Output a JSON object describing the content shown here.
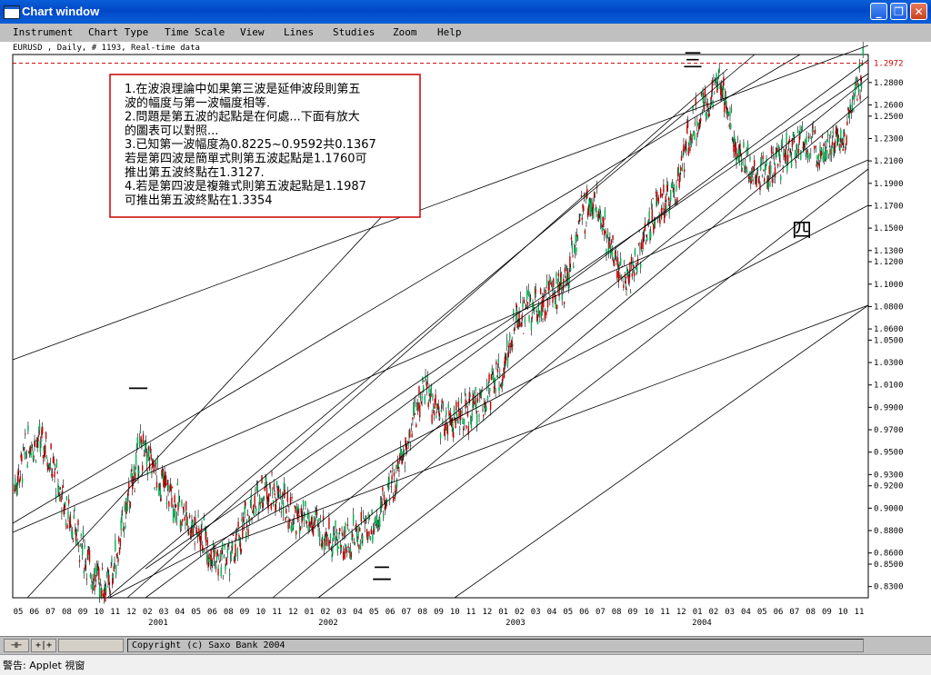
{
  "window": {
    "title": "Chart window"
  },
  "menu": [
    "Instrument",
    "Chart Type",
    "Time Scale",
    "View",
    "Lines",
    "Studies",
    "Zoom",
    "Help"
  ],
  "chart_header": "EURUSD , Daily, # 1193, Real-time data",
  "annotation_lines": [
    "1.在波浪理論中如果第三波是延伸波段則第五",
    "波的幅度与第一波幅度相等.",
    "2.問題是第五波的起點是在何處...下面有放大",
    "的圖表可以對照...",
    "3.已知第一波幅度為0.8225~0.9592共0.1367",
    "若是第四波是簡單式則第五波起點是1.1760可",
    "推出第五波終點在1.3127.",
    "4.若是第四波是複雜式則第五波起點是1.1987",
    "可推出第五波終點在1.3354"
  ],
  "wave_labels": [
    "一",
    "二",
    "三",
    "四"
  ],
  "status": {
    "btn1": "⊣⊢",
    "btn2": "+|+",
    "copyright": "Copyright (c) Saxo Bank 2004"
  },
  "java_status": "警告: Applet 視窗",
  "colors": {
    "up_bar": "#00b050",
    "down_bar": "#c00000",
    "price_line": "#cc0000",
    "title_bar": "#0a5fd8",
    "annotation_border": "#cc0000"
  },
  "chart_data": {
    "type": "candlestick",
    "instrument": "EURUSD",
    "timeframe": "Daily",
    "last_price": "1.2972",
    "ylim": [
      0.82,
      1.305
    ],
    "y_ticks": [
      "1.2800",
      "1.2600",
      "1.2500",
      "1.2300",
      "1.2100",
      "1.1900",
      "1.1700",
      "1.1500",
      "1.1300",
      "1.1200",
      "1.1000",
      "1.0800",
      "1.0600",
      "1.0500",
      "1.0300",
      "1.0100",
      "0.9900",
      "0.9700",
      "0.9500",
      "0.9300",
      "0.9200",
      "0.9000",
      "0.8800",
      "0.8600",
      "0.8500",
      "0.8300"
    ],
    "x_month_labels": [
      "05",
      "06",
      "07",
      "08",
      "09",
      "10",
      "11",
      "12",
      "02",
      "03",
      "04",
      "05",
      "06",
      "08",
      "09",
      "10",
      "11",
      "12",
      "01",
      "02",
      "03",
      "04",
      "05",
      "06",
      "07",
      "08",
      "09",
      "10",
      "11",
      "12",
      "01",
      "02",
      "03",
      "04",
      "05",
      "06",
      "07",
      "08",
      "09",
      "10",
      "11",
      "12",
      "01",
      "02",
      "03",
      "04",
      "05",
      "06",
      "07",
      "08",
      "09",
      "10",
      "11"
    ],
    "x_year_labels": [
      "2001",
      "2002",
      "2003",
      "2004"
    ],
    "price_path": [
      [
        "2000-05",
        0.92
      ],
      [
        "2000-06",
        0.96
      ],
      [
        "2000-07",
        0.955
      ],
      [
        "2000-08",
        0.91
      ],
      [
        "2000-09",
        0.875
      ],
      [
        "2000-10",
        0.84
      ],
      [
        "2000-11",
        0.83
      ],
      [
        "2000-12",
        0.89
      ],
      [
        "2001-01",
        0.955
      ],
      [
        "2001-02",
        0.93
      ],
      [
        "2001-03",
        0.91
      ],
      [
        "2001-04",
        0.89
      ],
      [
        "2001-05",
        0.875
      ],
      [
        "2001-06",
        0.85
      ],
      [
        "2001-07",
        0.86
      ],
      [
        "2001-08",
        0.9
      ],
      [
        "2001-09",
        0.92
      ],
      [
        "2001-10",
        0.905
      ],
      [
        "2001-11",
        0.89
      ],
      [
        "2001-12",
        0.885
      ],
      [
        "2002-01",
        0.875
      ],
      [
        "2002-02",
        0.87
      ],
      [
        "2002-03",
        0.88
      ],
      [
        "2002-04",
        0.89
      ],
      [
        "2002-05",
        0.92
      ],
      [
        "2002-06",
        0.96
      ],
      [
        "2002-07",
        1.01
      ],
      [
        "2002-08",
        0.98
      ],
      [
        "2002-09",
        0.98
      ],
      [
        "2002-10",
        0.985
      ],
      [
        "2002-11",
        1.0
      ],
      [
        "2002-12",
        1.02
      ],
      [
        "2003-01",
        1.07
      ],
      [
        "2003-02",
        1.08
      ],
      [
        "2003-03",
        1.09
      ],
      [
        "2003-04",
        1.1
      ],
      [
        "2003-05",
        1.16
      ],
      [
        "2003-06",
        1.175
      ],
      [
        "2003-07",
        1.13
      ],
      [
        "2003-08",
        1.1
      ],
      [
        "2003-09",
        1.14
      ],
      [
        "2003-10",
        1.17
      ],
      [
        "2003-11",
        1.18
      ],
      [
        "2003-12",
        1.24
      ],
      [
        "2004-01",
        1.26
      ],
      [
        "2004-02",
        1.28
      ],
      [
        "2004-03",
        1.22
      ],
      [
        "2004-04",
        1.2
      ],
      [
        "2004-05",
        1.2
      ],
      [
        "2004-06",
        1.215
      ],
      [
        "2004-07",
        1.23
      ],
      [
        "2004-08",
        1.22
      ],
      [
        "2004-09",
        1.225
      ],
      [
        "2004-10",
        1.24
      ],
      [
        "2004-11",
        1.297
      ]
    ]
  }
}
